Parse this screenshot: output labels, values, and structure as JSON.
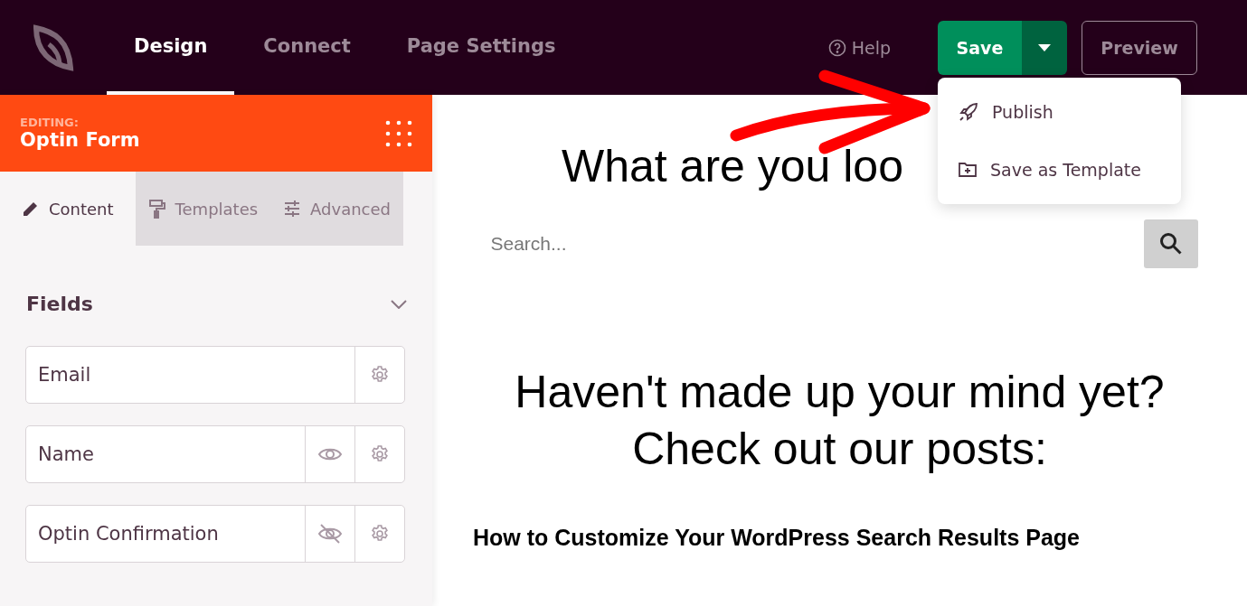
{
  "top_nav": {
    "tabs": [
      {
        "label": "Design",
        "selected": true
      },
      {
        "label": "Connect",
        "selected": false
      },
      {
        "label": "Page Settings",
        "selected": false
      }
    ],
    "help": "Help",
    "save": "Save",
    "preview": "Preview"
  },
  "save_menu": {
    "items": [
      {
        "kind": "publish",
        "label": "Publish"
      },
      {
        "kind": "template",
        "label": "Save as Template"
      }
    ]
  },
  "sidebar": {
    "editing_label": "EDITING:",
    "editing_title": "Optin Form",
    "tabs": [
      {
        "kind": "content",
        "label": "Content",
        "selected": true
      },
      {
        "kind": "templates",
        "label": "Templates",
        "selected": false
      },
      {
        "kind": "advanced",
        "label": "Advanced",
        "selected": false
      }
    ],
    "section": {
      "title": "Fields",
      "expanded": true
    },
    "fields": [
      {
        "label": "Email"
      },
      {
        "label": "Name",
        "visible": true
      },
      {
        "label": "Optin Confirmation",
        "visible": false
      }
    ]
  },
  "canvas": {
    "heading": "What are you loo",
    "search_placeholder": "Search...",
    "subheading_lines": [
      "Haven't made up your mind yet?",
      "Check out our posts:"
    ],
    "post_title": "How to Customize Your WordPress Search Results Page"
  }
}
